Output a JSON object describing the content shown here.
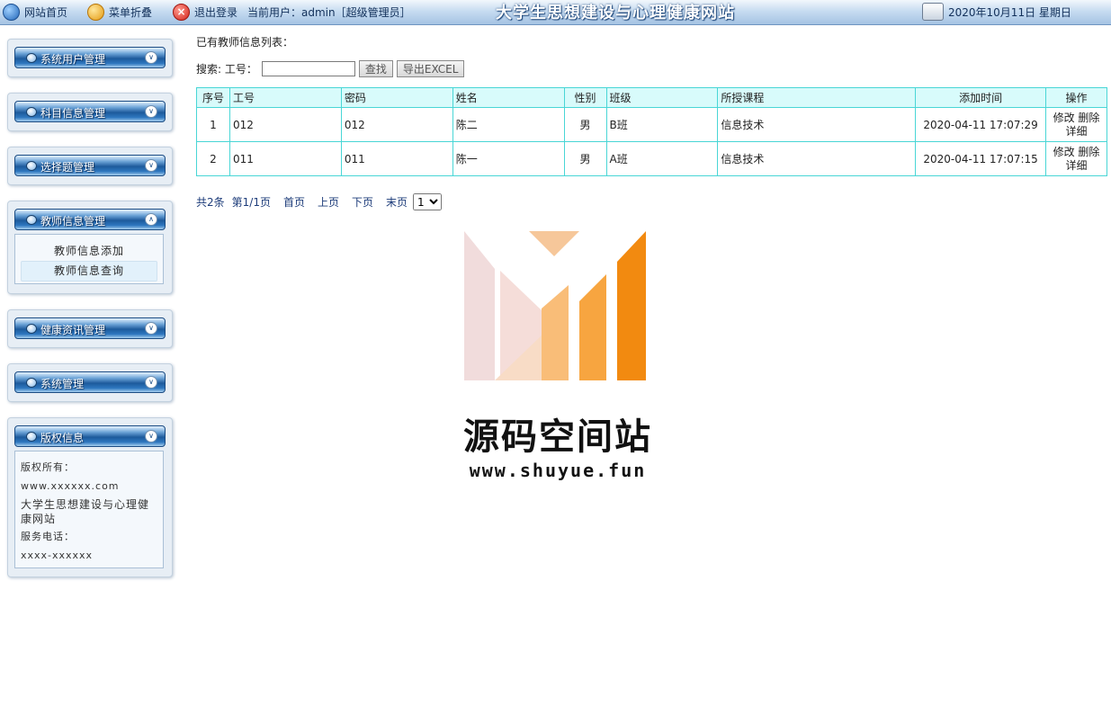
{
  "topbar": {
    "home": "网站首页",
    "fold": "菜单折叠",
    "logout": "退出登录",
    "current_user": "当前用户：admin［超级管理员］",
    "site_title": "大学生思想建设与心理健康网站",
    "date": "2020年10月11日 星期日"
  },
  "sidebar": {
    "panels": [
      {
        "title": "系统用户管理"
      },
      {
        "title": "科目信息管理"
      },
      {
        "title": "选择题管理"
      },
      {
        "title": "教师信息管理",
        "items": [
          "教师信息添加",
          "教师信息查询"
        ],
        "active_item": "教师信息查询"
      },
      {
        "title": "健康资讯管理"
      },
      {
        "title": "系统管理"
      },
      {
        "title": "版权信息",
        "lines": [
          "版权所有：",
          "www.xxxxxx.com",
          "大学生思想建设与心理健康网站",
          "服务电话：",
          "xxxx-xxxxxx"
        ]
      }
    ]
  },
  "main": {
    "list_label": "已有教师信息列表：",
    "search_label": "搜索: 工号：",
    "search_value": "",
    "search_button": "查找",
    "export_button": "导出EXCEL",
    "table": {
      "headers": [
        "序号",
        "工号",
        "密码",
        "姓名",
        "性别",
        "班级",
        "所授课程",
        "添加时间",
        "操作"
      ],
      "rows": [
        {
          "seq": "1",
          "id": "012",
          "password": "012",
          "name": "陈二",
          "gender": "男",
          "class": "B班",
          "course": "信息技术",
          "time": "2020-04-11 17:07:29"
        },
        {
          "seq": "2",
          "id": "011",
          "password": "011",
          "name": "陈一",
          "gender": "男",
          "class": "A班",
          "course": "信息技术",
          "time": "2020-04-11 17:07:15"
        }
      ],
      "ops": {
        "edit": "修改",
        "delete": "删除",
        "detail": "详细"
      }
    },
    "pager": {
      "total": "共2条",
      "page": "第1/1页",
      "first": "首页",
      "prev": "上页",
      "next": "下页",
      "last": "末页",
      "select_value": "1"
    }
  },
  "watermark": {
    "name": "源码空间站",
    "url": "www.shuyue.fun"
  }
}
